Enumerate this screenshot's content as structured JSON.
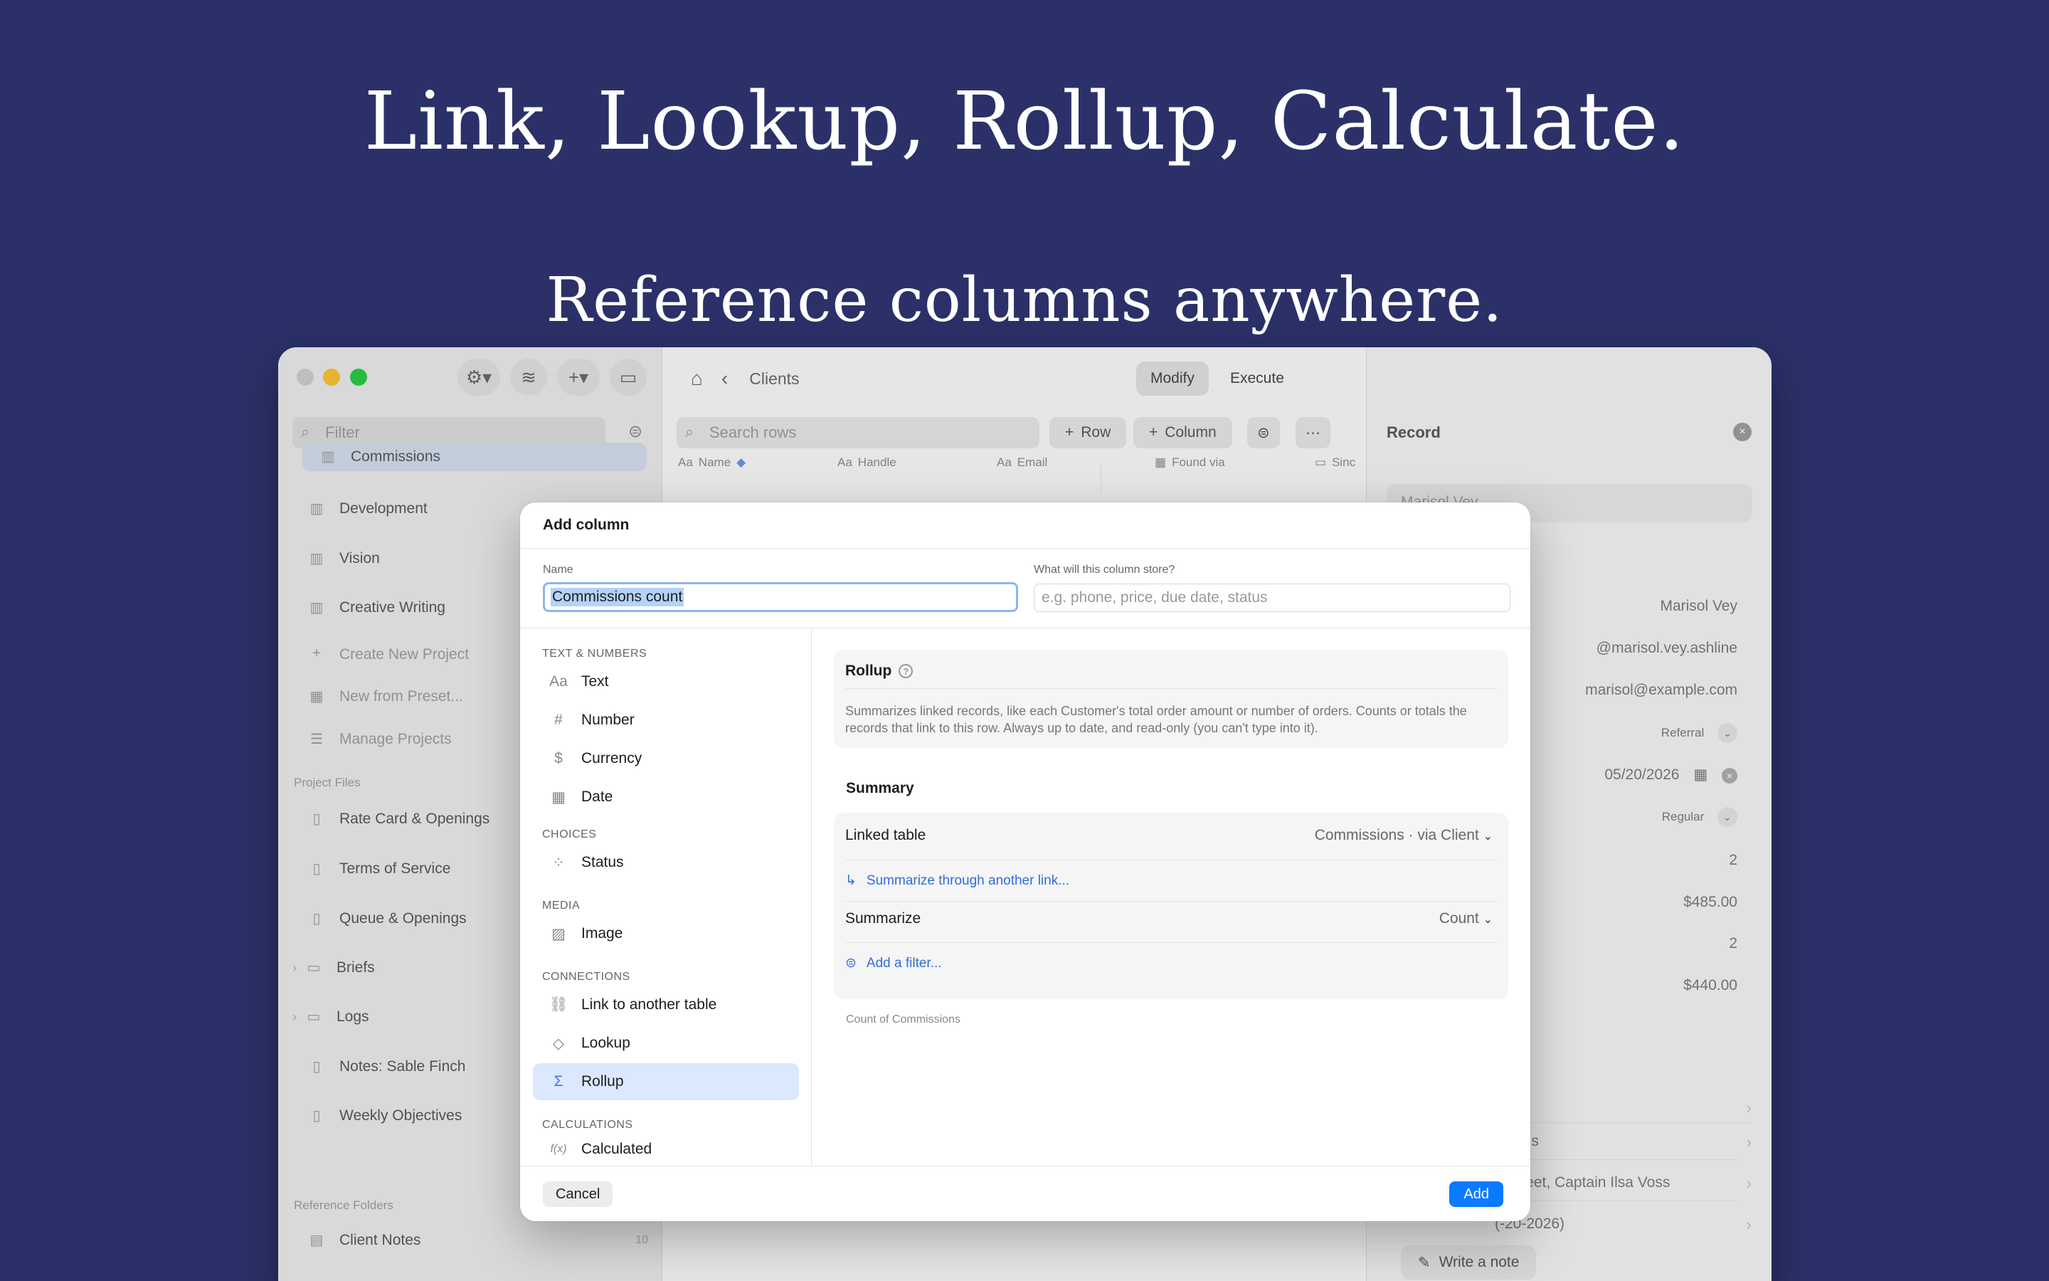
{
  "hero": {
    "title": "Link, Lookup, Rollup, Calculate.",
    "subtitle": "Reference columns anywhere."
  },
  "window": {
    "sidebar": {
      "filter_placeholder": "Filter",
      "items": [
        {
          "label": "Commissions"
        },
        {
          "label": "Development"
        },
        {
          "label": "Vision"
        },
        {
          "label": "Creative Writing"
        },
        {
          "label": "Create New Project"
        },
        {
          "label": "New from Preset..."
        },
        {
          "label": "Manage Projects"
        }
      ],
      "project_files_header": "Project Files",
      "files": [
        {
          "label": "Rate Card & Openings"
        },
        {
          "label": "Terms of Service"
        },
        {
          "label": "Queue & Openings"
        },
        {
          "label": "Briefs"
        },
        {
          "label": "Logs"
        },
        {
          "label": "Notes: Sable Finch"
        },
        {
          "label": "Weekly Objectives"
        }
      ],
      "reference_header": "Reference Folders",
      "reference_items": [
        {
          "label": "Client Notes",
          "count": "10"
        }
      ]
    },
    "main": {
      "breadcrumb": "Clients",
      "modes": [
        "Modify",
        "Execute"
      ],
      "search_placeholder": "Search rows",
      "row_button": "Row",
      "column_button": "Column",
      "columns": [
        {
          "prefix": "Aa",
          "label": "Name"
        },
        {
          "prefix": "Aa",
          "label": "Handle"
        },
        {
          "prefix": "Aa",
          "label": "Email"
        },
        {
          "prefix": "▦",
          "label": "Found via"
        },
        {
          "prefix": "▭",
          "label": "Sinc"
        }
      ]
    },
    "record": {
      "title": "Record",
      "top_value": "Marisol Vey",
      "values": [
        "Marisol Vey",
        "@marisol.vey.ashline",
        "marisol@example.com",
        "Referral",
        "05/20/2026",
        "Regular",
        "2",
        "$485.00",
        "2",
        "$440.00"
      ],
      "links": [
        "ngs",
        "e Sheet, Captain Ilsa Voss",
        "(-20-2026)"
      ],
      "note_button": "Write a note"
    }
  },
  "dialog": {
    "title": "Add column",
    "name_label": "Name",
    "name_value": "Commissions count",
    "store_label": "What will this column store?",
    "store_placeholder": "e.g. phone, price, due date, status",
    "sections": {
      "text_numbers": "TEXT & NUMBERS",
      "choices": "CHOICES",
      "media": "MEDIA",
      "connections": "CONNECTIONS",
      "calculations": "CALCULATIONS"
    },
    "types": {
      "text": "Text",
      "number": "Number",
      "currency": "Currency",
      "date": "Date",
      "status": "Status",
      "image": "Image",
      "link": "Link to another table",
      "lookup": "Lookup",
      "rollup": "Rollup",
      "calculated": "Calculated"
    },
    "detail": {
      "type_title": "Rollup",
      "description": "Summarizes linked records, like each Customer's total order amount or number of orders. Counts or totals the records that link to this row. Always up to date, and read-only (you can't type into it).",
      "summary_header": "Summary",
      "linked_table_label": "Linked table",
      "linked_table_value": "Commissions · via Client",
      "through_link": "Summarize through another link...",
      "summarize_label": "Summarize",
      "summarize_value": "Count",
      "add_filter": "Add a filter...",
      "footnote": "Count of Commissions"
    },
    "cancel": "Cancel",
    "add": "Add"
  }
}
